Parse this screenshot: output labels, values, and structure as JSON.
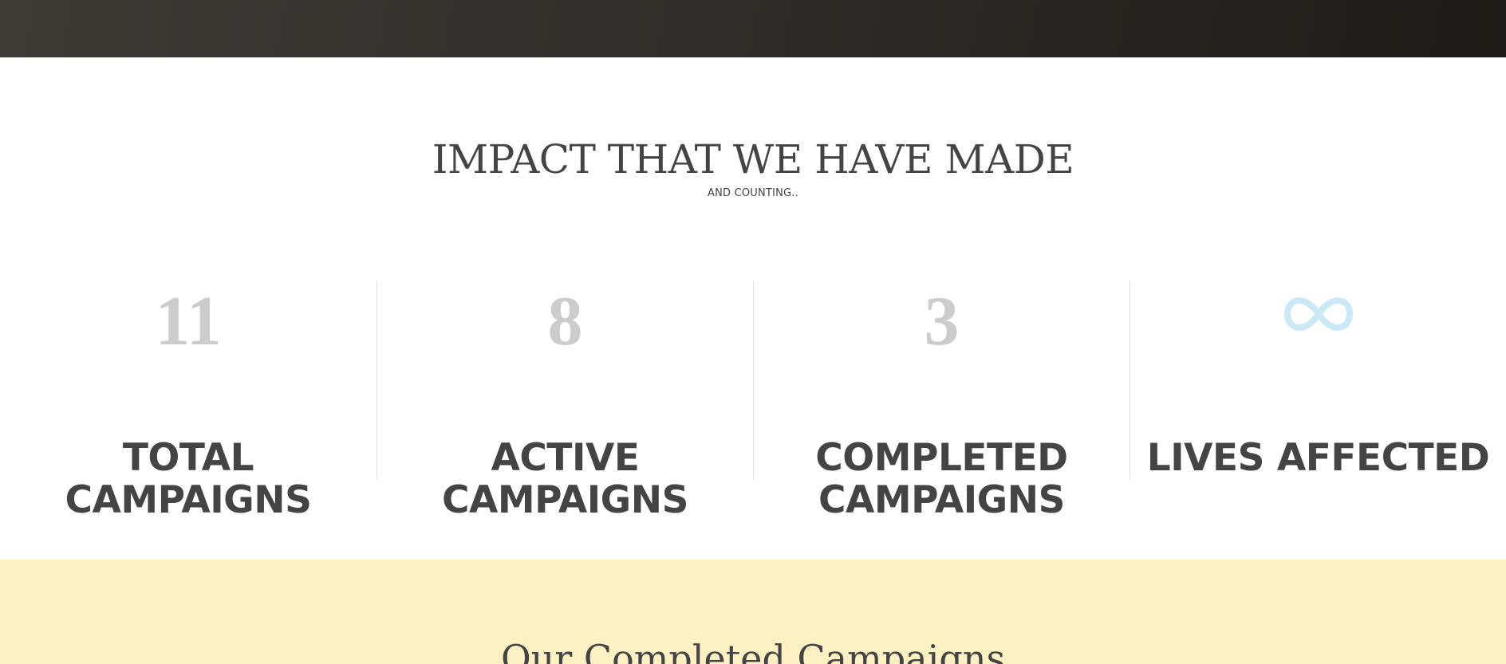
{
  "impact": {
    "title": "IMPACT THAT WE HAVE MADE",
    "subtitle": "AND COUNTING.."
  },
  "stats": [
    {
      "value": "11",
      "label_line1": "TOTAL",
      "label_line2": "CAMPAIGNS"
    },
    {
      "value": "8",
      "label_line1": "ACTIVE",
      "label_line2": "CAMPAIGNS"
    },
    {
      "value": "3",
      "label_line1": "COMPLETED",
      "label_line2": "CAMPAIGNS"
    },
    {
      "icon": "infinity-icon",
      "label_line1": "LIVES AFFECTED"
    }
  ],
  "completed": {
    "title": "Our Completed Campaigns"
  },
  "colors": {
    "header_bar": "#312d2a",
    "number_gray": "#cccccc",
    "text_dark": "#444444",
    "infinity_blue": "#cbe8f7",
    "section_yellow": "#fdf1c3"
  }
}
